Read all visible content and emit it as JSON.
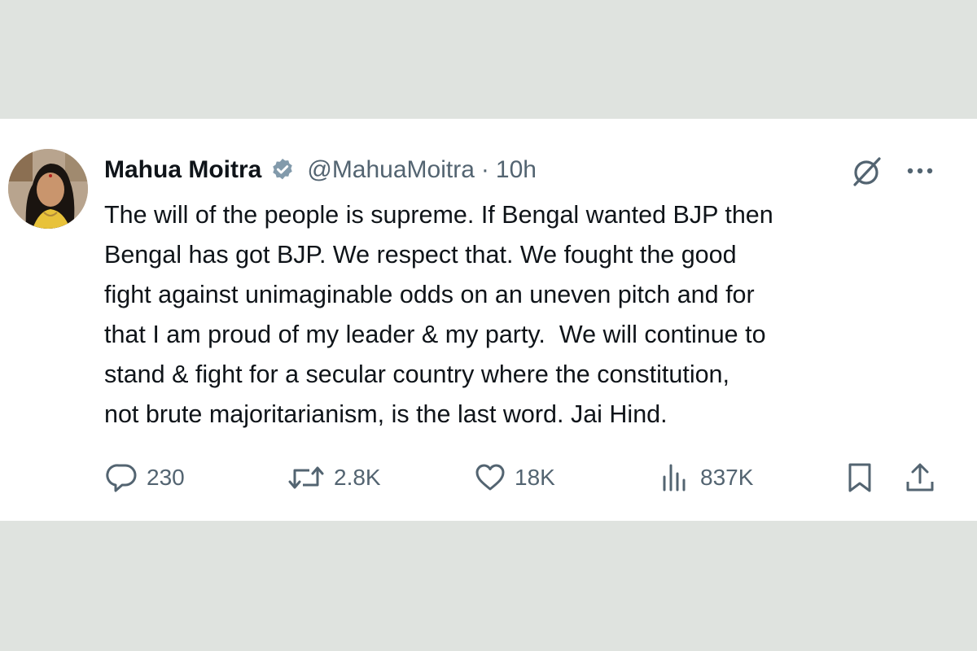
{
  "tweet": {
    "author_name": "Mahua Moitra",
    "handle": "@MahuaMoitra",
    "separator": "·",
    "time": "10h",
    "text_lines": [
      "The will of the people is supreme. If Bengal wanted BJP then",
      "Bengal has got BJP. We respect that. We fought the good",
      "fight against unimaginable odds on an uneven pitch and for",
      "that I am proud of my leader & my party.  We will continue to",
      "stand & fight for a secular country where the constitution,",
      "not brute majoritarianism, is the last word. Jai Hind."
    ]
  },
  "actions": {
    "replies": "230",
    "retweets": "2.8K",
    "likes": "18K",
    "views": "837K"
  },
  "icons": {
    "avatar": "profile-photo",
    "verified": "verified-badge-icon",
    "grok": "grok-icon",
    "more": "more-horizontal-icon",
    "reply": "reply-icon",
    "retweet": "retweet-icon",
    "like": "heart-icon",
    "views": "views-icon",
    "bookmark": "bookmark-icon",
    "share": "share-icon"
  },
  "colors": {
    "background": "#dfe3df",
    "card": "#ffffff",
    "text_primary": "#0f1419",
    "text_secondary": "#536471",
    "verified": "#829aab"
  }
}
